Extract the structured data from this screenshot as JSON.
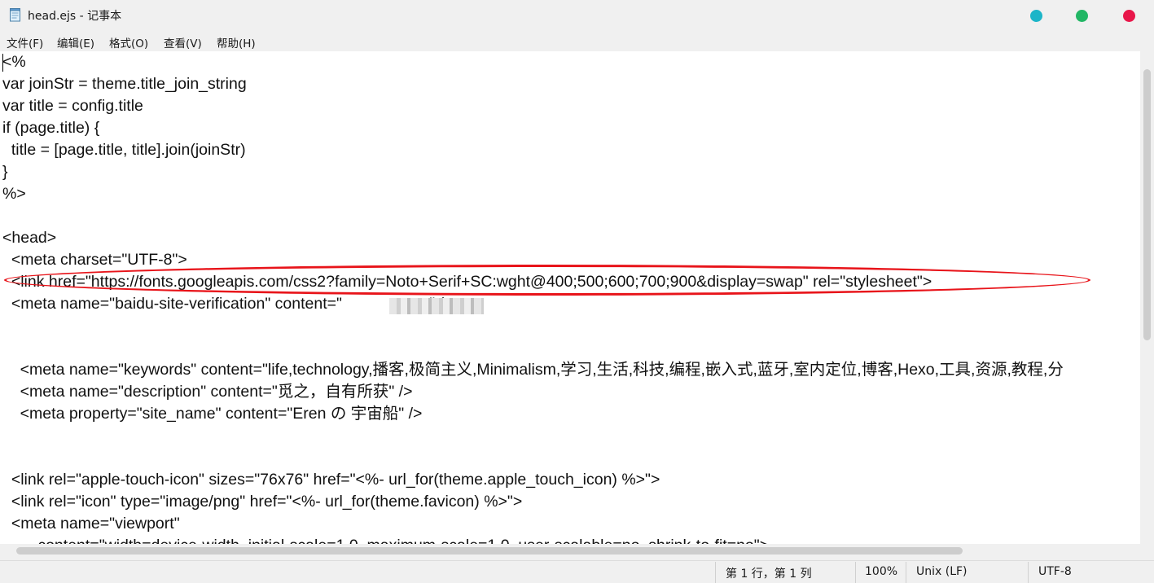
{
  "window": {
    "title": "head.ejs - 记事本",
    "icon": "notepad-icon",
    "controls": [
      "teal-dot",
      "green-dot",
      "red-dot"
    ],
    "colors": {
      "teal": "#1cb5c8",
      "green": "#22b665",
      "red": "#e8174a",
      "highlight": "#e8141a"
    }
  },
  "menu": [
    "文件(F)",
    "编辑(E)",
    "格式(O)",
    "查看(V)",
    "帮助(H)"
  ],
  "editor": {
    "lines": [
      "<%",
      "var joinStr = theme.title_join_string",
      "var title = config.title",
      "if (page.title) {",
      "  title = [page.title, title].join(joinStr)",
      "}",
      "%>",
      "",
      "<head>",
      "  <meta charset=\"UTF-8\">",
      "  <link href=\"https://fonts.googleapis.com/css2?family=Noto+Serif+SC:wght@400;500;600;700;900&display=swap\" rel=\"stylesheet\">",
      "  <meta name=\"baidu-site-verification\" content=\"                  y\" />",
      "",
      "",
      "    <meta name=\"keywords\" content=\"life,technology,播客,极简主义,Minimalism,学习,生活,科技,编程,嵌入式,蓝牙,室内定位,博客,Hexo,工具,资源,教程,分",
      "    <meta name=\"description\" content=\"觅之，自有所获\" />",
      "    <meta property=\"site_name\" content=\"Eren の 宇宙船\" />",
      "",
      "",
      "  <link rel=\"apple-touch-icon\" sizes=\"76x76\" href=\"<%- url_for(theme.apple_touch_icon) %>\">",
      "  <link rel=\"icon\" type=\"image/png\" href=\"<%- url_for(theme.favicon) %>\">",
      "  <meta name=\"viewport\"",
      "        content=\"width=device-width, initial-scale=1.0, maximum-scale=1.0, user-scalable=no, shrink-to-fit=no\">"
    ]
  },
  "status": {
    "position": "第 1 行，第 1 列",
    "zoom": "100%",
    "line_ending": "Unix (LF)",
    "encoding": "UTF-8"
  }
}
